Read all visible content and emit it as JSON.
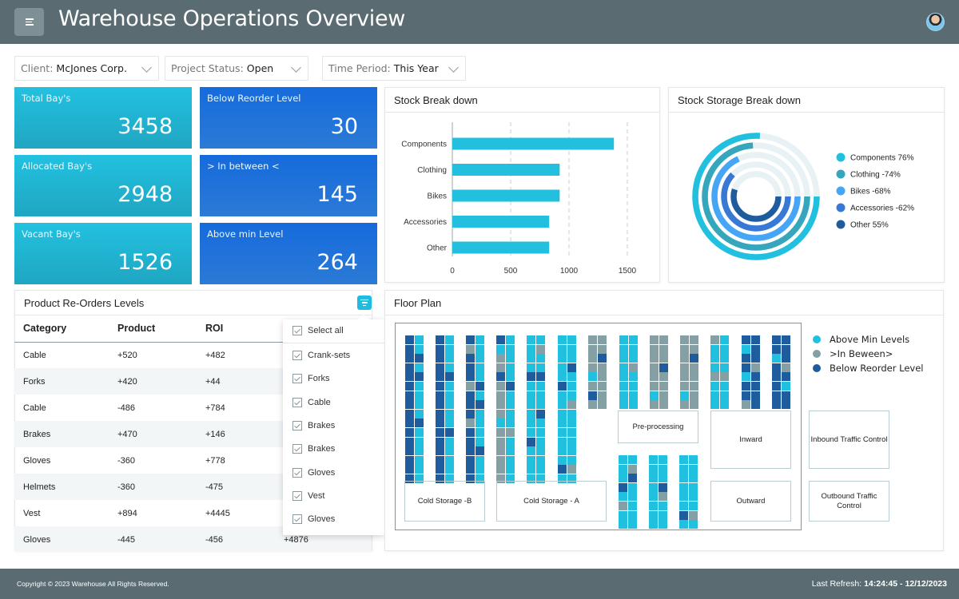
{
  "header": {
    "title": "Warehouse Operations Overview",
    "menu_icon": "hamburger-icon",
    "avatar": "user-avatar"
  },
  "filters": [
    {
      "label": "Client:",
      "value": "McJones Corp."
    },
    {
      "label": "Project Status:",
      "value": "Open"
    },
    {
      "label": "Time Period:",
      "value": "This Year"
    }
  ],
  "kpis": [
    {
      "label": "Total Bay's",
      "value": "3458"
    },
    {
      "label": "Below Reorder Level",
      "value": "30"
    },
    {
      "label": "Allocated Bay's",
      "value": "2948"
    },
    {
      "label": "> In between <",
      "value": "145"
    },
    {
      "label": "Vacant Bay's",
      "value": "1526"
    },
    {
      "label": "Above min Level",
      "value": "264"
    }
  ],
  "stock_breakdown": {
    "title": "Stock Break down"
  },
  "stock_storage": {
    "title": "Stock Storage Break down",
    "legend": [
      "Components  76%",
      "Clothing -74%",
      "Bikes -68%",
      "Accessories -62%",
      "Other 55%"
    ]
  },
  "chart_data": [
    {
      "type": "bar",
      "orientation": "horizontal",
      "title": "Stock Break down",
      "categories": [
        "Components",
        "Clothing",
        "Bikes",
        "Accessories",
        "Other"
      ],
      "values": [
        1385,
        920,
        920,
        830,
        830
      ],
      "xlim": [
        0,
        1500
      ],
      "xticks": [
        "0",
        "500",
        "1000",
        "1500"
      ],
      "grid": "vertical-dashed",
      "color": "#22bfdf"
    },
    {
      "type": "radial-bar",
      "title": "Stock Storage Break down",
      "categories": [
        "Components",
        "Clothing",
        "Bikes",
        "Accessories",
        "Other"
      ],
      "values": [
        76,
        74,
        68,
        62,
        55
      ],
      "unit": "%",
      "colors": [
        "#22c0df",
        "#36a6bd",
        "#46a5f5",
        "#3779d5",
        "#1f5c9e"
      ],
      "track_color": "#e8f1f3",
      "legend": "right"
    }
  ],
  "reorders": {
    "title": "Product Re-Orders Levels",
    "columns": [
      "Category",
      "Product",
      "ROI",
      ""
    ],
    "rows": [
      [
        "Cable",
        "+520",
        "+482",
        ""
      ],
      [
        "Forks",
        "+420",
        "+44",
        ""
      ],
      [
        "Cable",
        "-486",
        "+784",
        ""
      ],
      [
        "Brakes",
        "+470",
        "+146",
        ""
      ],
      [
        "Gloves",
        "-360",
        "+778",
        ""
      ],
      [
        "Helmets",
        "-360",
        "-475",
        ""
      ],
      [
        "Vest",
        "+894",
        "+4445",
        ""
      ],
      [
        "Gloves",
        "-445",
        "-456",
        "+4876"
      ]
    ],
    "filter_popup": {
      "select_all": "Select all",
      "options": [
        "Crank-sets",
        "Forks",
        "Cable",
        "Brakes",
        "Brakes",
        "Gloves",
        "Vest",
        "Gloves"
      ],
      "checked": [
        true,
        true,
        true,
        true,
        true,
        true,
        true,
        true,
        true
      ]
    }
  },
  "floor_plan": {
    "title": "Floor Plan",
    "legend": [
      {
        "label": "Above Min Levels",
        "color": "#22c0df",
        "key": "c"
      },
      {
        "label": ">In Beween>",
        "color": "#84a0a5",
        "key": "g"
      },
      {
        "label": "Below Reorder Level",
        "color": "#1f5c9e",
        "key": "d"
      }
    ],
    "rooms": [
      "Pre-processing",
      "Inward",
      "Cold Storage -B",
      "Cold Storage - A",
      "Inbound Traffic Control",
      "Outbound Traffic Control",
      "Outward"
    ],
    "tall_racks": [
      [
        "dddddddddddddddd",
        "ccdcdccccdcccccc"
      ],
      [
        "dddddddddddddddd",
        "ccccdcccccdccccc"
      ],
      [
        "dgdddgdddgdddddd",
        "cccccdcdccccdccc"
      ],
      [
        "dcggdggggcgggggg",
        "cccccdccccgccccc"
      ],
      [
        "ccccdccccccdcccc",
        "cgccdcccdccccccc"
      ],
      [
        "cccccdccccccccdc",
        "cccdcccgccccccgc"
      ]
    ],
    "short_racks": [
      [
        "ggggcgdg",
        "ggdggggg"
      ],
      [
        "cccccccc",
        "cccgcccc"
      ],
      [
        "ggggggcg",
        "gggdgggg"
      ],
      [
        "ggggggcg",
        "ggdggggg"
      ],
      [
        "gcccgccc",
        "ccccgccc"
      ],
      [
        "dcddcddg",
        "dddgdddd"
      ],
      [
        "ddcddddd",
        "dddgdcdd"
      ]
    ],
    "bottom_racks": [
      [
        "cccdcgcc",
        "cgdccccc"
      ],
      [
        "cccccccc",
        "cccdgccc"
      ],
      [
        "ccccccdc",
        "ccccccgc"
      ]
    ]
  },
  "footer": {
    "copyright": "Copyright © 2023 Warehouse All Rights Reserved.",
    "refresh_label": "Last Refresh:",
    "refresh_value": "14:24:45 - 12/12/2023"
  }
}
